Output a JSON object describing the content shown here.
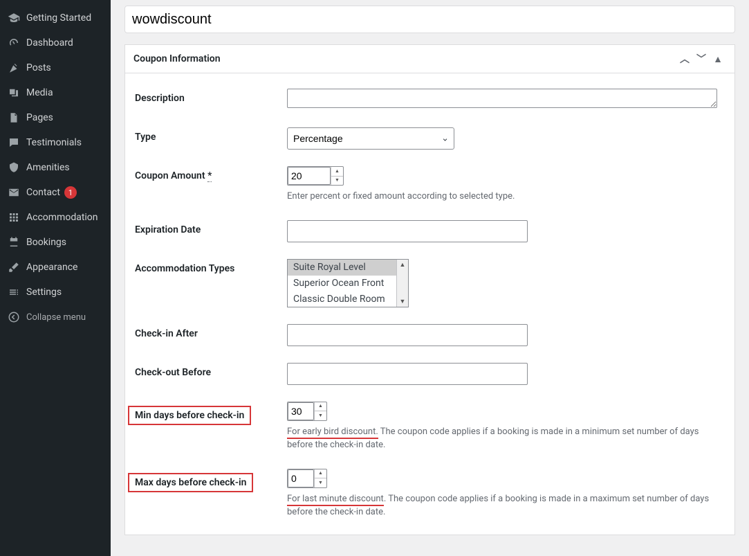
{
  "sidebar": {
    "items": [
      {
        "label": "Getting Started"
      },
      {
        "label": "Dashboard"
      },
      {
        "label": "Posts"
      },
      {
        "label": "Media"
      },
      {
        "label": "Pages"
      },
      {
        "label": "Testimonials"
      },
      {
        "label": "Amenities"
      },
      {
        "label": "Contact",
        "badge": "1"
      },
      {
        "label": "Accommodation"
      },
      {
        "label": "Bookings"
      },
      {
        "label": "Appearance"
      },
      {
        "label": "Settings"
      }
    ],
    "collapse": "Collapse menu"
  },
  "title_value": "wowdiscount",
  "panel": {
    "title": "Coupon Information",
    "fields": {
      "description": {
        "label": "Description",
        "value": ""
      },
      "type": {
        "label": "Type",
        "selected": "Percentage"
      },
      "amount": {
        "label": "Coupon Amount ",
        "required_mark": "*",
        "value": "20",
        "help": "Enter percent or fixed amount according to selected type."
      },
      "expiration": {
        "label": "Expiration Date",
        "value": ""
      },
      "accom_types": {
        "label": "Accommodation Types",
        "options": [
          "Suite Royal Level",
          "Superior Ocean Front",
          "Classic Double Room"
        ]
      },
      "checkin_after": {
        "label": "Check-in After",
        "value": ""
      },
      "checkout_before": {
        "label": "Check-out Before",
        "value": ""
      },
      "min_days": {
        "label": "Min days before check-in",
        "value": "30",
        "help_lead": "For early bird discount.",
        "help_rest": " The coupon code applies if a booking is made in a minimum set number of days before the check-in date."
      },
      "max_days": {
        "label": "Max days before check-in",
        "value": "0",
        "help_lead": "For last minute discount",
        "help_rest": ". The coupon code applies if a booking is made in a maximum set number of days before the check-in date."
      }
    }
  }
}
